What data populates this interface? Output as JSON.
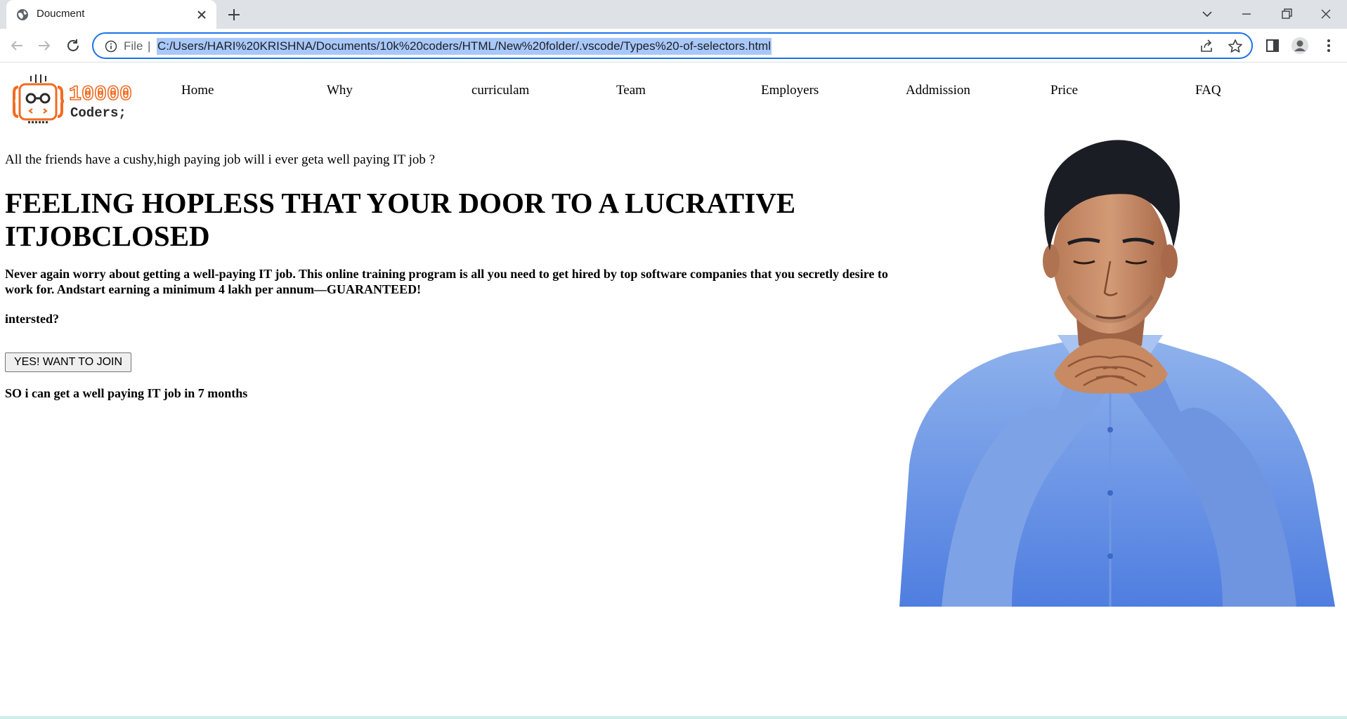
{
  "browser": {
    "tab_title": "Doucment",
    "omnibox_scheme": "File",
    "omnibox_separator": "|",
    "url": "C:/Users/HARI%20KRISHNA/Documents/10k%20coders/HTML/New%20folder/.vscode/Types%20-of-selectors.html"
  },
  "logo": {
    "digits": "10000",
    "word": "Coders;"
  },
  "nav": {
    "items": [
      "Home",
      "Why",
      "curriculam",
      "Team",
      "Employers",
      "Addmission",
      "Price",
      "FAQ"
    ]
  },
  "hero": {
    "tagline": "All the friends have a cushy,high paying job will i ever geta well paying IT job ?",
    "headline": "FEELING HOPLESS THAT YOUR DOOR TO A LUCRATIVE ITJOBCLOSED",
    "description": "Never again worry about getting a well-paying IT job. This online training program is all you need to get hired by top software companies that you secretly desire to work for. Andstart earning a minimum 4 lakh per annum—GUARANTEED!",
    "question": "intersted?",
    "cta_label": "YES! WANT TO JOIN",
    "outcome": "SO i can get a well paying IT job in 7 months"
  },
  "colors": {
    "omnibox_focus": "#1a73e8",
    "url_selection": "#a8c7fa",
    "logo_orange": "#f26b21",
    "logo_dark": "#2b2b2b"
  }
}
